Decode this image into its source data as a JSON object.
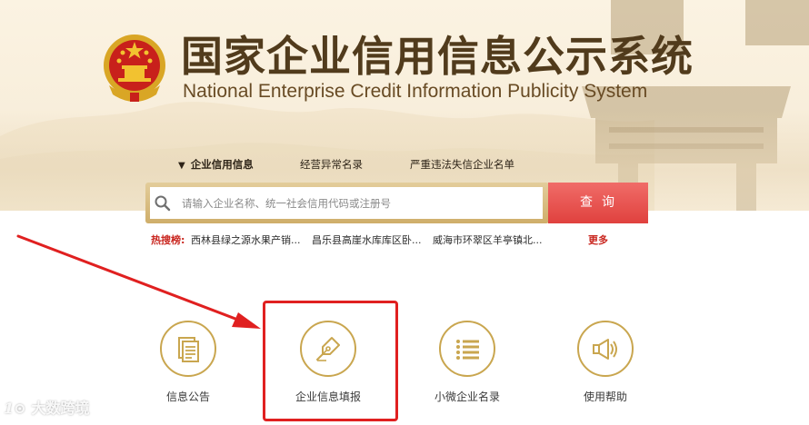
{
  "header": {
    "title_cn": "国家企业信用信息公示系统",
    "title_en": "National Enterprise Credit Information Publicity System",
    "emblem_icon": "national-emblem-icon"
  },
  "tabs": [
    {
      "label": "企业信用信息",
      "active": true
    },
    {
      "label": "经营异常名录",
      "active": false
    },
    {
      "label": "严重违法失信企业名单",
      "active": false
    }
  ],
  "tab_caret": "▼",
  "search": {
    "placeholder": "请输入企业名称、统一社会信用代码或注册号",
    "value": "",
    "button_label": "查询"
  },
  "hot_search": {
    "label": "热搜榜:",
    "items": [
      "西林县绿之源水果产销...",
      "昌乐县高崖水库库区卧...",
      "威海市环翠区羊亭镇北..."
    ],
    "more_label": "更多"
  },
  "features": [
    {
      "label": "信息公告",
      "icon": "document-icon"
    },
    {
      "label": "企业信息填报",
      "icon": "pen-nib-icon",
      "highlighted": true
    },
    {
      "label": "小微企业名录",
      "icon": "list-icon"
    },
    {
      "label": "使用帮助",
      "icon": "megaphone-icon"
    }
  ],
  "watermark": {
    "logo": "1⊙",
    "text": "大数跨境"
  },
  "colors": {
    "brand_brown": "#513b1c",
    "gold": "#c9a64f",
    "search_red": "#e0413e",
    "hot_red": "#c9261f",
    "annotation_red": "#e02020"
  }
}
